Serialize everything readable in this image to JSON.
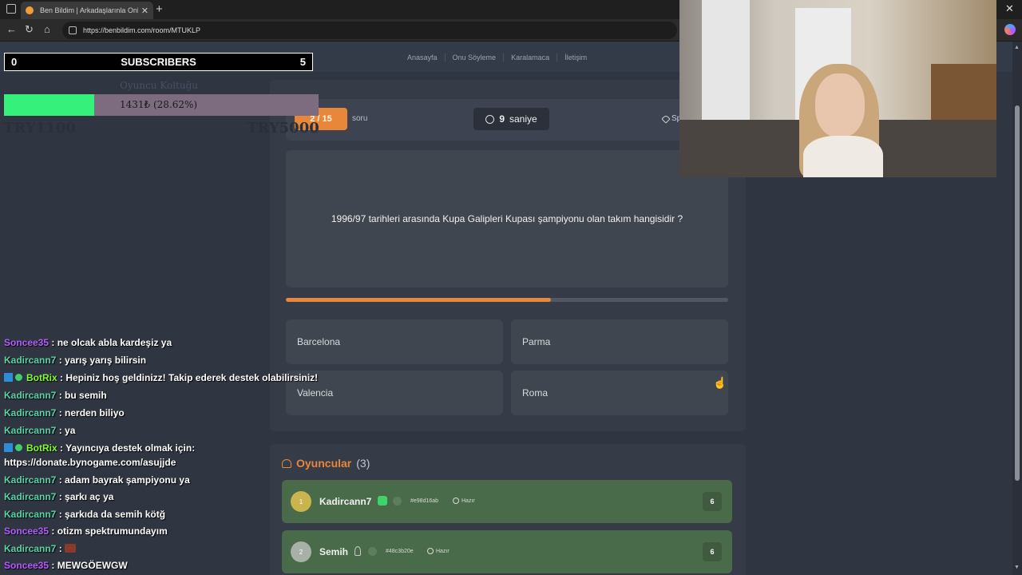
{
  "browser": {
    "tab_title": "Ben Bildim | Arkadaşlarınla Online",
    "url": "https://benbildim.com/room/MTUKLP"
  },
  "site_nav": [
    "Anasayfa",
    "Onu Söyleme",
    "Karalamaca",
    "İletişim"
  ],
  "game": {
    "question_number": "2 / 15",
    "question_suffix": "soru",
    "timer_value": "9",
    "timer_unit": "saniye",
    "category_partial": "Sp",
    "question": "1996/97 tarihleri arasında Kupa Galipleri Kupası şampiyonu olan takım hangisidir ?",
    "time_progress": 0.6,
    "answers": [
      "Barcelona",
      "Parma",
      "Valencia",
      "Roma"
    ]
  },
  "players": {
    "title": "Oyuncular",
    "count": "(3)",
    "list": [
      {
        "rank": "1",
        "name": "Kadircann7",
        "hash": "#e98d16ab",
        "status": "Hazır",
        "score": "6"
      },
      {
        "rank": "2",
        "name": "Semih",
        "hash": "#48c3b20e",
        "status": "Hazır",
        "score": "6"
      }
    ]
  },
  "overlay": {
    "sub_left": "0",
    "sub_label": "SUBSCRIBERS",
    "sub_right": "5",
    "donation_label": "Oyuncu Koltuğu",
    "donation_text": "1431₺ (28.62%)",
    "donation_progress": 0.2862,
    "donation_min": "TRY1100",
    "donation_max": "TRY5000"
  },
  "chat": [
    {
      "user": "Soncee35",
      "text": " : ne olcak abla kardeşiz ya",
      "color": "purple"
    },
    {
      "user": "Kadircann7",
      "text": " : yarış yarış bilirsin",
      "color": "teal"
    },
    {
      "user": "BotRix",
      "text": " : Hepiniz hoş geldinizz! Takip ederek destek olabilirsiniz!",
      "color": "green",
      "bot": true
    },
    {
      "user": "Kadircann7",
      "text": " : bu semih",
      "color": "teal"
    },
    {
      "user": "Kadircann7",
      "text": " : nerden biliyo",
      "color": "teal"
    },
    {
      "user": "Kadircann7",
      "text": " : ya",
      "color": "teal"
    },
    {
      "user": "BotRix",
      "text": " : Yayıncıya destek olmak için:",
      "color": "green",
      "bot": true
    },
    {
      "user": "",
      "text": "https://donate.bynogame.com/asujjde",
      "color": "none"
    },
    {
      "user": "Kadircann7",
      "text": " : adam bayrak şampiyonu ya",
      "color": "teal"
    },
    {
      "user": "Kadircann7",
      "text": " : şarkı aç ya",
      "color": "teal"
    },
    {
      "user": "Kadircann7",
      "text": " : şarkıda da semih kötğ",
      "color": "teal"
    },
    {
      "user": "Soncee35",
      "text": " : otizm spektrumundayım",
      "color": "purple"
    },
    {
      "user": "Kadircann7",
      "text": " : ",
      "color": "teal",
      "emote": true
    },
    {
      "user": "Soncee35",
      "text": " : MEWGÖEWGW",
      "color": "purple"
    }
  ]
}
